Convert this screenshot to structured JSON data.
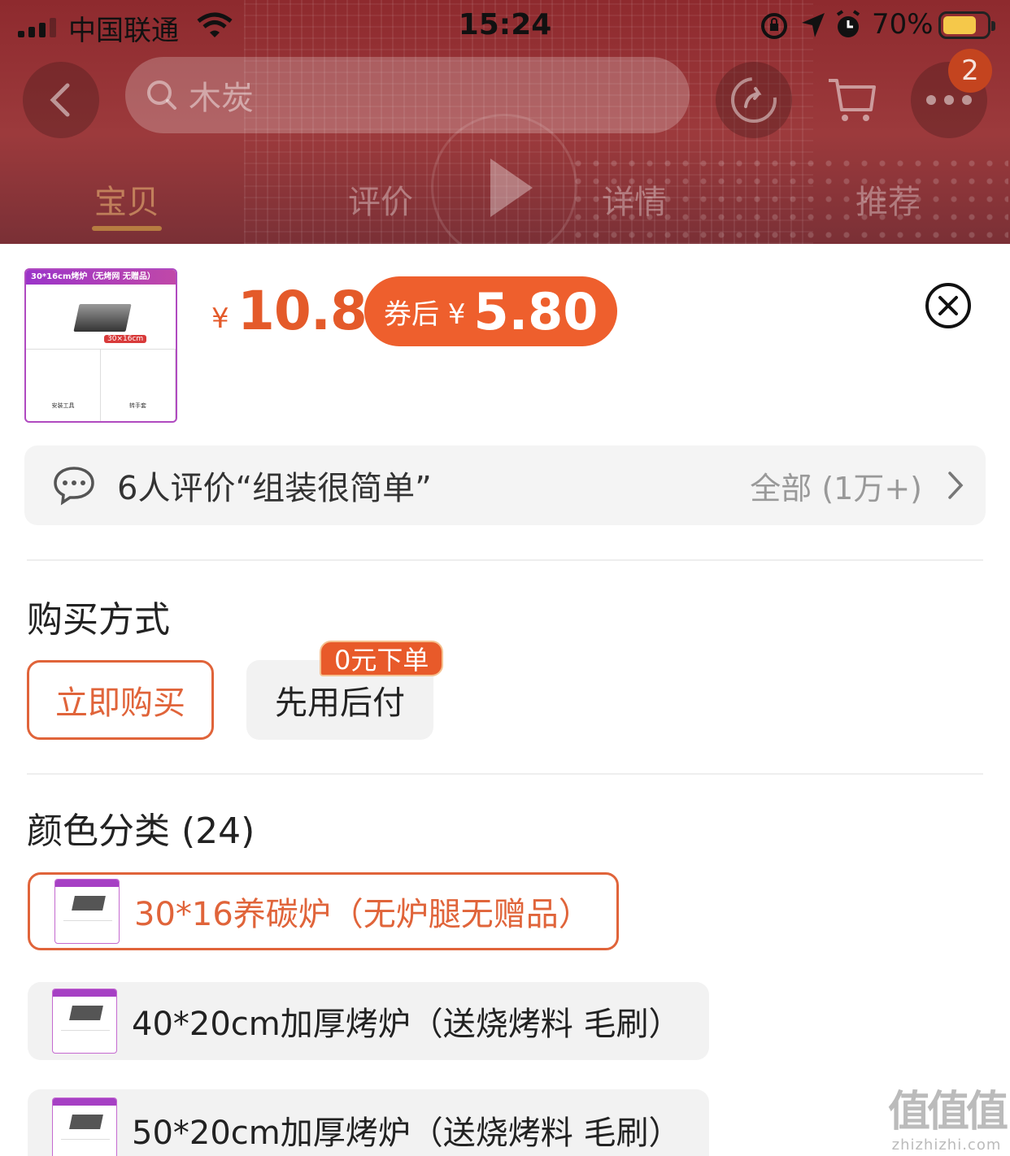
{
  "status_bar": {
    "carrier": "中国联通",
    "time": "15:24",
    "battery_percent": "70%",
    "battery_level": 0.7
  },
  "nav": {
    "search_placeholder": "木炭",
    "more_badge": "2"
  },
  "tabs": [
    {
      "label": "宝贝",
      "active": true
    },
    {
      "label": "评价",
      "active": false
    },
    {
      "label": "详情",
      "active": false
    },
    {
      "label": "推荐",
      "active": false
    }
  ],
  "product": {
    "thumb_title": "30*16cm烤炉（无烤网 无赠品）",
    "thumb_tag": "30×16cm",
    "thumb_captions": [
      "安装工具",
      "转手套"
    ],
    "currency": "¥",
    "price": "10.8",
    "coupon_label": "券后 ¥",
    "coupon_price": "5.80"
  },
  "review": {
    "text": "6人评价“组装很简单”",
    "all_label": "全部 (1万+)"
  },
  "purchase": {
    "title": "购买方式",
    "options": [
      {
        "label": "立即购买",
        "selected": true
      },
      {
        "label": "先用后付",
        "selected": false
      }
    ],
    "promo_tag": "0元下单"
  },
  "color": {
    "title": "颜色分类 (24)",
    "variants": [
      {
        "label": "30*16养碳炉（无炉腿无赠品）",
        "selected": true
      },
      {
        "label": "40*20cm加厚烤炉（送烧烤料 毛刷）",
        "selected": false
      },
      {
        "label": "50*20cm加厚烤炉（送烧烤料 毛刷）",
        "selected": false
      }
    ]
  },
  "watermark": {
    "big": "值值值",
    "small": "zhizhizhi.com"
  },
  "colors": {
    "accent": "#ee5f2d",
    "price": "#e45a2a",
    "selected_border": "#e0643a",
    "banner": "#8e2a2e"
  }
}
